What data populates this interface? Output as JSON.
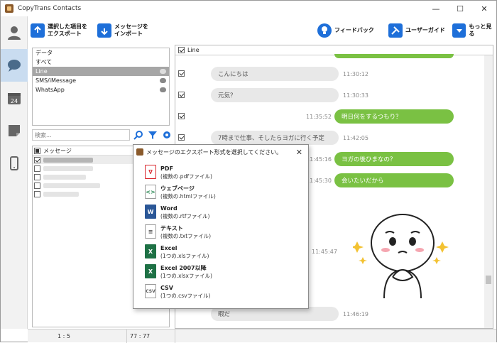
{
  "window": {
    "title": "CopyTrans Contacts"
  },
  "toolbar": {
    "export_selected": "選択した項目を\nエクスポート",
    "import_messages": "メッセージを\nインポート",
    "feedback": "フィードバック",
    "user_guide": "ユーザーガイド",
    "more": "もっと見る"
  },
  "categories": [
    {
      "label": "データ",
      "icon": ""
    },
    {
      "label": "すべて",
      "icon": ""
    },
    {
      "label": "Line",
      "icon": "line-icon"
    },
    {
      "label": "SMS/iMessage",
      "icon": "message-icon"
    },
    {
      "label": "WhatsApp",
      "icon": "whatsapp-icon"
    }
  ],
  "search": {
    "placeholder": "検索..."
  },
  "message_list": {
    "header": "メッセージ"
  },
  "chat": {
    "header": "Line",
    "messages": [
      {
        "dir": "in",
        "text": "こんにちは",
        "time": "11:30:12"
      },
      {
        "dir": "in",
        "text": "元気？",
        "time": "11:30:33"
      },
      {
        "dir": "out",
        "text": "明日何をするつもり？",
        "time": "11:35:52"
      },
      {
        "dir": "in",
        "text": "7時まで仕事、そしたらヨガに行く予定",
        "time": "11:42:05"
      },
      {
        "dir": "out",
        "text": "ヨガの後ひまなの？",
        "time": "11:45:16"
      },
      {
        "dir": "out",
        "text": "会いたいだから",
        "time": "11:45:30"
      },
      {
        "dir": "out",
        "text": "",
        "time": "11:45:47"
      },
      {
        "dir": "in",
        "text": "暇だ",
        "time": "11:46:19"
      }
    ]
  },
  "status": {
    "left": "1 : 5",
    "right": "77 : 77"
  },
  "dialog": {
    "title": "メッセージのエクスポート形式を選択してください。",
    "options": [
      {
        "name": "PDF",
        "desc": "(複数の.pdfファイル)",
        "icon": "pdf-icon",
        "color": "#d9242a"
      },
      {
        "name": "ウェブページ",
        "desc": "(複数の.htmlファイル)",
        "icon": "html-icon",
        "color": "#2e8b57"
      },
      {
        "name": "Word",
        "desc": "(複数の.rtfファイル)",
        "icon": "word-icon",
        "color": "#2b5797"
      },
      {
        "name": "テキスト",
        "desc": "(複数の.txtファイル)",
        "icon": "text-icon",
        "color": "#555555"
      },
      {
        "name": "Excel",
        "desc": "(1つの.xlsファイル)",
        "icon": "excel-icon",
        "color": "#1e7145"
      },
      {
        "name": "Excel 2007以降",
        "desc": "(1つの.xlsxファイル)",
        "icon": "excel-xlsx-icon",
        "color": "#1e7145"
      },
      {
        "name": "CSV",
        "desc": "(1つの.csvファイル)",
        "icon": "csv-icon",
        "color": "#555555"
      }
    ]
  },
  "colors": {
    "accent": "#c9dcf0",
    "bubble_out": "#7ac143",
    "bubble_in": "#e8e8e8",
    "toolbar_icon": "#1e6fd9"
  }
}
